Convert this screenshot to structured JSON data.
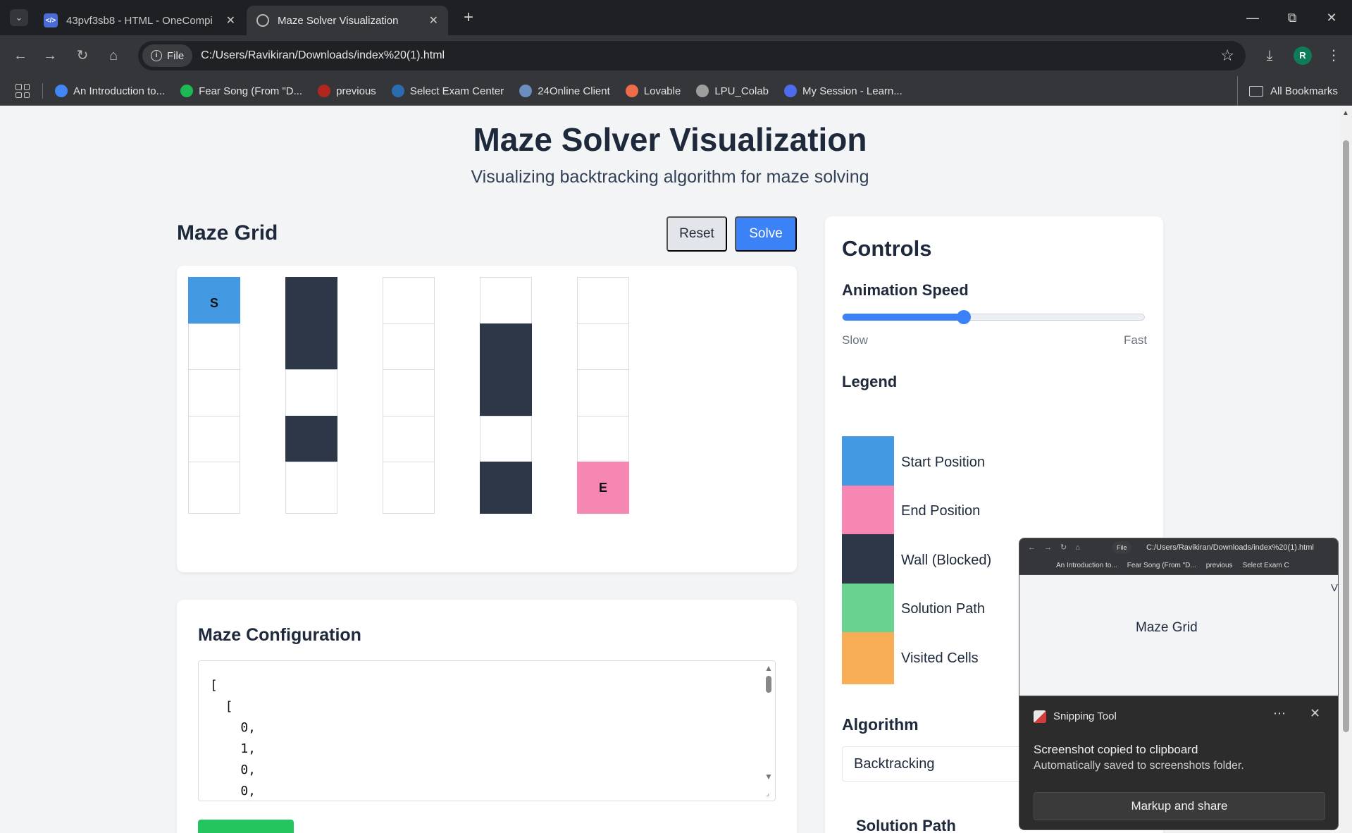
{
  "browser": {
    "tabs": [
      {
        "title": "43pvf3sb8 - HTML - OneCompi",
        "favicon": "</>"
      },
      {
        "title": "Maze Solver Visualization"
      }
    ],
    "url_chip": "File",
    "url": "C:/Users/Ravikiran/Downloads/index%20(1).html",
    "avatar_letter": "R",
    "bookmarks": [
      {
        "label": "An Introduction to...",
        "color": "#4285f4"
      },
      {
        "label": "Fear Song (From \"D...",
        "color": "#1db954"
      },
      {
        "label": "previous",
        "color": "#b3261e"
      },
      {
        "label": "Select Exam Center",
        "color": "#2b6cb0"
      },
      {
        "label": "24Online Client",
        "color": "#6c8ebf"
      },
      {
        "label": "Lovable",
        "color": "#ef6c4a"
      },
      {
        "label": "LPU_Colab",
        "color": "#9e9e9e"
      },
      {
        "label": "My Session - Learn...",
        "color": "#4f6bed"
      }
    ],
    "all_bookmarks": "All Bookmarks"
  },
  "page": {
    "title": "Maze Solver Visualization",
    "subtitle": "Visualizing backtracking algorithm for maze solving",
    "grid_heading": "Maze Grid",
    "reset_label": "Reset",
    "solve_label": "Solve",
    "maze": [
      [
        "S",
        "wall",
        "open",
        "open",
        "open"
      ],
      [
        "open",
        "wall",
        "open",
        "wall",
        "open"
      ],
      [
        "open",
        "open",
        "open",
        "wall",
        "open"
      ],
      [
        "open",
        "wall",
        "open",
        "open",
        "open"
      ],
      [
        "open",
        "open",
        "open",
        "wall",
        "E"
      ]
    ],
    "config_heading": "Maze Configuration",
    "config_text": "[\n  [\n    0,\n    1,\n    0,\n    0,"
  },
  "controls": {
    "heading": "Controls",
    "speed_label": "Animation Speed",
    "speed_value": 0.4,
    "slow": "Slow",
    "fast": "Fast",
    "legend_heading": "Legend",
    "legend": [
      {
        "label": "Start Position",
        "color": "#4299e1"
      },
      {
        "label": "End Position",
        "color": "#f687b3"
      },
      {
        "label": "Wall (Blocked)",
        "color": "#2d3748"
      },
      {
        "label": "Solution Path",
        "color": "#68d391"
      },
      {
        "label": "Visited Cells",
        "color": "#f6ad55"
      }
    ],
    "algorithm_heading": "Algorithm",
    "algorithm_value": "Backtracking",
    "solution_path_heading": "Solution Path"
  },
  "snip_preview": {
    "chip": "File",
    "url": "C:/Users/Ravikiran/Downloads/index%20(1).html",
    "bookmarks": [
      "An Introduction to...",
      "Fear Song (From \"D...",
      "previous",
      "Select Exam C"
    ],
    "grid_heading": "Maze Grid",
    "clip_text": "Vi"
  },
  "toast": {
    "app_name": "Snipping Tool",
    "title": "Screenshot copied to clipboard",
    "body": "Automatically saved to screenshots folder.",
    "button": "Markup and share"
  }
}
